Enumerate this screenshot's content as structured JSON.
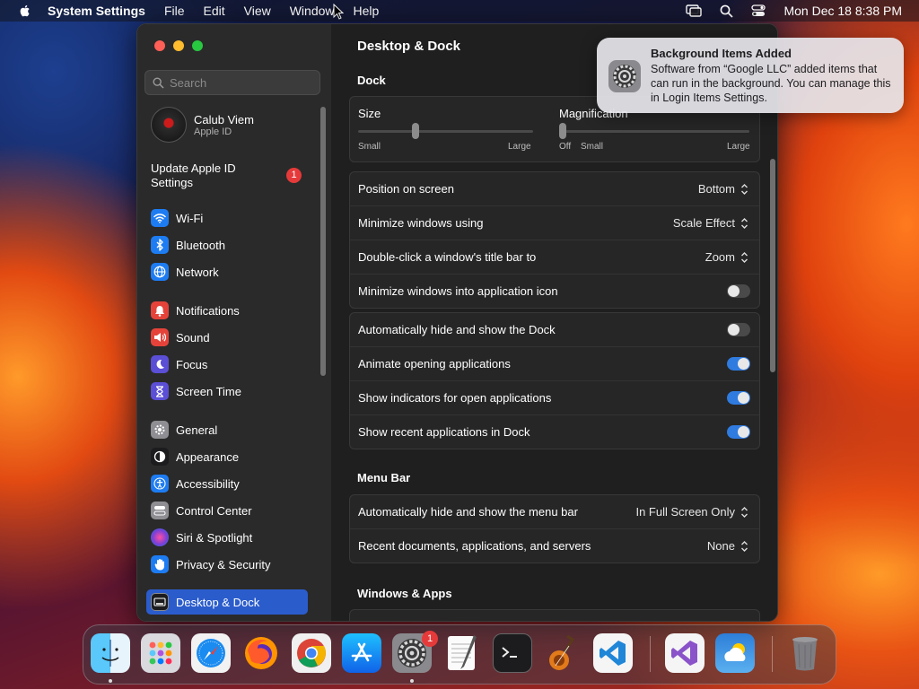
{
  "menubar": {
    "app": "System Settings",
    "menus": [
      "File",
      "Edit",
      "View",
      "Window",
      "Help"
    ],
    "clock": "Mon Dec 18  8:38 PM"
  },
  "sidebar": {
    "search_placeholder": "Search",
    "account": {
      "name": "Calub Viem",
      "sub": "Apple ID"
    },
    "update": {
      "label": "Update Apple ID Settings",
      "badge": "1"
    },
    "items": [
      {
        "label": "Wi-Fi",
        "icon": "wifi-icon",
        "color": "#1e7cf2"
      },
      {
        "label": "Bluetooth",
        "icon": "bluetooth-icon",
        "color": "#1e7cf2"
      },
      {
        "label": "Network",
        "icon": "globe-icon",
        "color": "#1e7cf2"
      },
      {
        "label": "Notifications",
        "icon": "bell-icon",
        "color": "#e5433a"
      },
      {
        "label": "Sound",
        "icon": "speaker-icon",
        "color": "#e5433a"
      },
      {
        "label": "Focus",
        "icon": "moon-icon",
        "color": "#5b4fd6"
      },
      {
        "label": "Screen Time",
        "icon": "hourglass-icon",
        "color": "#5b4fd6"
      },
      {
        "label": "General",
        "icon": "gear-icon",
        "color": "#8e8e93"
      },
      {
        "label": "Appearance",
        "icon": "appearance-icon",
        "color": "#1c1c1e"
      },
      {
        "label": "Accessibility",
        "icon": "accessibility-icon",
        "color": "#1e7cf2"
      },
      {
        "label": "Control Center",
        "icon": "control-center-icon",
        "color": "#8e8e93"
      },
      {
        "label": "Siri & Spotlight",
        "icon": "siri-icon",
        "color": "#7a3fd6"
      },
      {
        "label": "Privacy & Security",
        "icon": "hand-icon",
        "color": "#1e7cf2"
      },
      {
        "label": "Desktop & Dock",
        "icon": "desktop-dock-icon",
        "color": "#1c1c1e",
        "selected": true
      }
    ]
  },
  "content": {
    "title": "Desktop & Dock",
    "dock_section": "Dock",
    "size": {
      "label": "Size",
      "min": "Small",
      "max": "Large",
      "value": 0.33
    },
    "magnification": {
      "label": "Magnification",
      "off": "Off",
      "min": "Small",
      "max": "Large",
      "value": 0.0
    },
    "dock_options": [
      {
        "label": "Position on screen",
        "value": "Bottom"
      },
      {
        "label": "Minimize windows using",
        "value": "Scale Effect"
      },
      {
        "label": "Double-click a window's title bar to",
        "value": "Zoom"
      },
      {
        "label": "Minimize windows into application icon",
        "toggle": false
      }
    ],
    "dock_toggles": [
      {
        "label": "Automatically hide and show the Dock",
        "toggle": false
      },
      {
        "label": "Animate opening applications",
        "toggle": true
      },
      {
        "label": "Show indicators for open applications",
        "toggle": true
      },
      {
        "label": "Show recent applications in Dock",
        "toggle": true
      }
    ],
    "menubar_section": "Menu Bar",
    "menubar_options": [
      {
        "label": "Automatically hide and show the menu bar",
        "value": "In Full Screen Only"
      },
      {
        "label": "Recent documents, applications, and servers",
        "value": "None"
      }
    ],
    "windows_section": "Windows & Apps"
  },
  "notification": {
    "title": "Background Items Added",
    "body": "Software from “Google LLC” added items that can run in the background. You can manage this in Login Items Settings."
  },
  "dock": {
    "apps": [
      {
        "name": "finder-icon",
        "running": true
      },
      {
        "name": "launchpad-icon"
      },
      {
        "name": "safari-icon"
      },
      {
        "name": "firefox-icon"
      },
      {
        "name": "chrome-icon"
      },
      {
        "name": "app-store-icon"
      },
      {
        "name": "system-settings-icon",
        "running": true,
        "badge": "1"
      },
      {
        "name": "textedit-icon"
      },
      {
        "name": "terminal-icon"
      },
      {
        "name": "garageband-icon"
      },
      {
        "name": "vscode-icon"
      },
      {
        "name": "visual-studio-icon"
      },
      {
        "name": "weather-icon"
      },
      {
        "name": "trash-icon"
      }
    ]
  }
}
